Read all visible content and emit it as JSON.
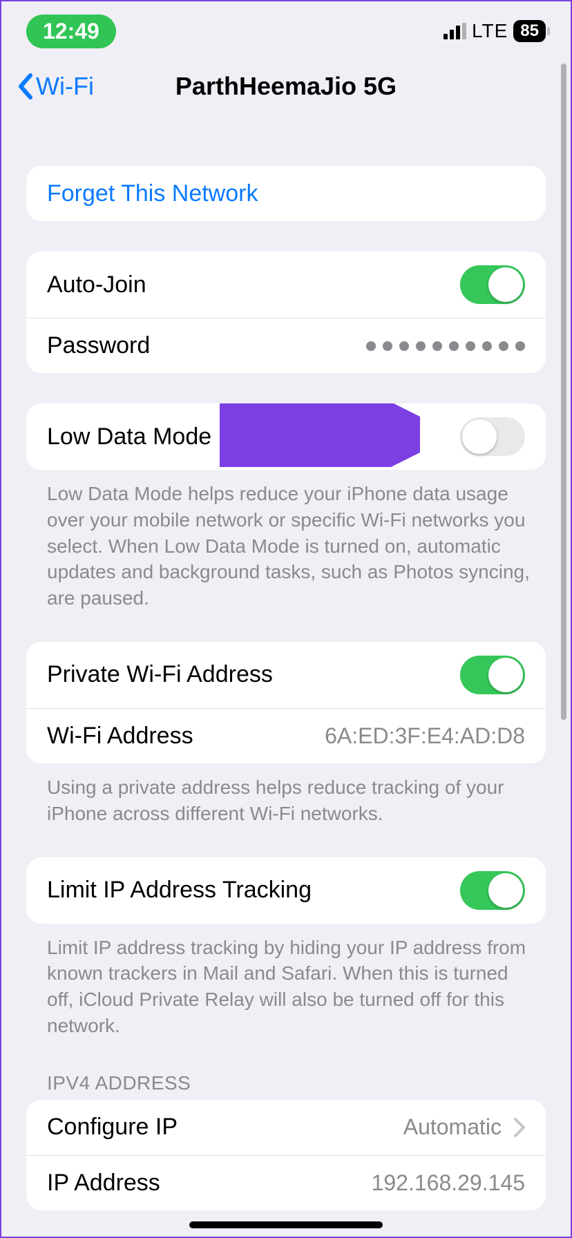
{
  "status": {
    "time": "12:49",
    "network_label": "LTE",
    "battery": "85"
  },
  "nav": {
    "back_label": "Wi-Fi",
    "title": "ParthHeemaJio 5G"
  },
  "forget": {
    "label": "Forget This Network"
  },
  "autojoin": {
    "label": "Auto-Join",
    "on": true
  },
  "password": {
    "label": "Password",
    "dot_count": 10
  },
  "lowdata": {
    "label": "Low Data Mode",
    "on": false,
    "footer": "Low Data Mode helps reduce your iPhone data usage over your mobile network or specific Wi-Fi networks you select. When Low Data Mode is turned on, automatic updates and background tasks, such as Photos syncing, are paused."
  },
  "private_addr": {
    "label": "Private Wi-Fi Address",
    "on": true
  },
  "wifi_addr": {
    "label": "Wi-Fi Address",
    "value": "6A:ED:3F:E4:AD:D8"
  },
  "private_footer": "Using a private address helps reduce tracking of your iPhone across different Wi-Fi networks.",
  "limit_ip": {
    "label": "Limit IP Address Tracking",
    "on": true,
    "footer": "Limit IP address tracking by hiding your IP address from known trackers in Mail and Safari. When this is turned off, iCloud Private Relay will also be turned off for this network."
  },
  "ipv4": {
    "header": "IPV4 ADDRESS",
    "configure": {
      "label": "Configure IP",
      "value": "Automatic"
    },
    "ip": {
      "label": "IP Address",
      "value": "192.168.29.145"
    }
  },
  "annotation": {
    "arrow_color": "#7b3fe4"
  }
}
